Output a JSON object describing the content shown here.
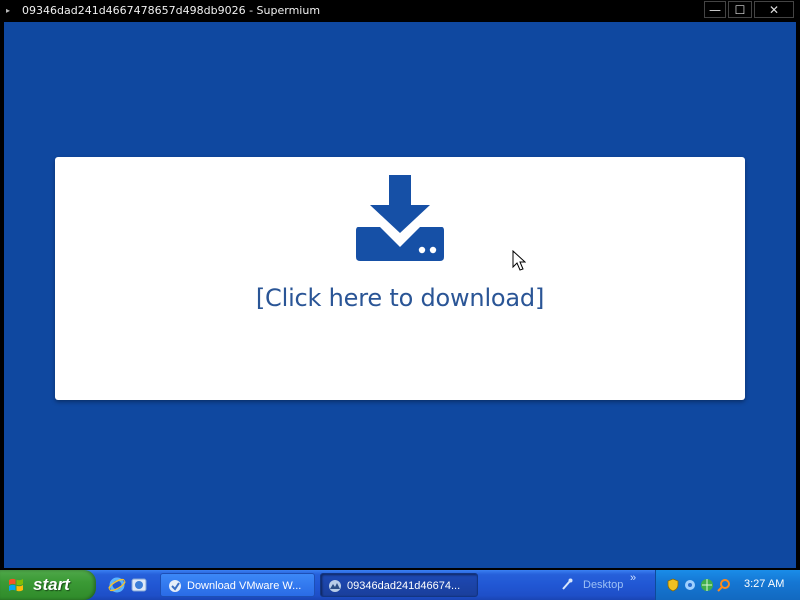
{
  "window": {
    "title": "09346dad241d4667478657d498db9026 - Supermium",
    "min_glyph": "—",
    "max_glyph": "☐",
    "close_glyph": "✕"
  },
  "page": {
    "background": "#0f48a0",
    "download_label": "[Click here to download]",
    "icon": "download-drive-icon",
    "accent": "#1650a6"
  },
  "taskbar": {
    "start_label": "start",
    "tasks": [
      {
        "label": "Download VMware W...",
        "icon": "vmware-icon",
        "active": false
      },
      {
        "label": "09346dad241d46674...",
        "icon": "supermium-icon",
        "active": true
      }
    ],
    "quick_launch": [
      "ie-icon",
      "explorer-icon"
    ],
    "desktop_label": "Desktop",
    "chevron": "»",
    "clock": "3:27 AM"
  }
}
